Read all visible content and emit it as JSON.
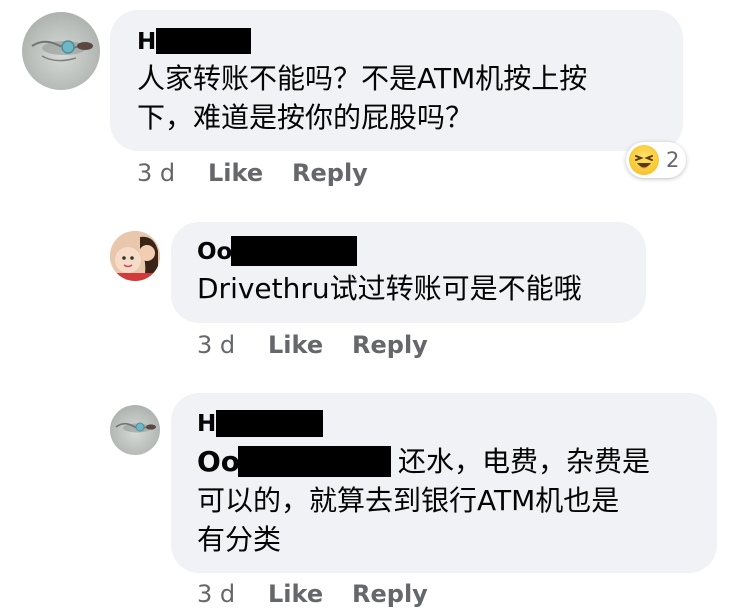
{
  "comments": [
    {
      "author_visible": "H",
      "lines": [
        "人家转账不能吗？不是ATM机按上按",
        "下，难道是按你的屁股吗？"
      ],
      "time": "3 d",
      "like_label": "Like",
      "reply_label": "Reply",
      "reaction": {
        "icon": "laughing-emoji-icon",
        "count": "2"
      }
    },
    {
      "author_visible": "Oo",
      "lines": [
        "Drivethru试过转账可是不能哦"
      ],
      "time": "3 d",
      "like_label": "Like",
      "reply_label": "Reply"
    },
    {
      "author_visible": "H",
      "mention_visible": "Oo",
      "lines": [
        "还水，电费，杂费是",
        "可以的，就算去到银行ATM机也是",
        "有分类"
      ],
      "time": "3 d",
      "like_label": "Like",
      "reply_label": "Reply"
    }
  ],
  "colors": {
    "bubble": "#f0f2f5",
    "text": "#050505",
    "secondary": "#65676b",
    "redaction": "#000000"
  }
}
